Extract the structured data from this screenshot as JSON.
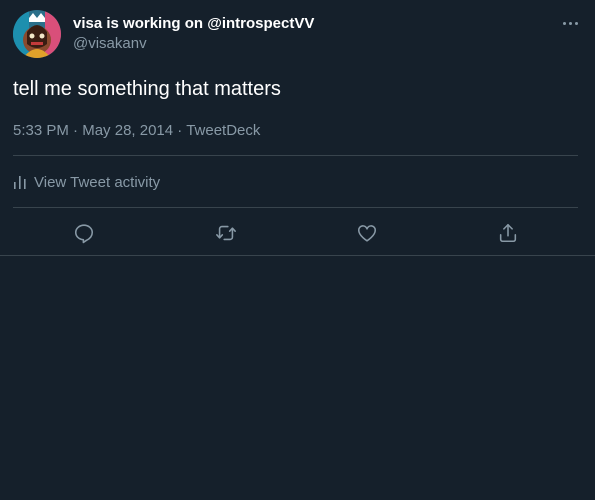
{
  "tweet": {
    "display_name": "visa is working on @introspectVV",
    "handle": "@visakanv",
    "text": "tell me something that matters",
    "time": "5:33 PM",
    "separator": " · ",
    "date": "May 28, 2014",
    "source": "TweetDeck"
  },
  "activity": {
    "label": "View Tweet activity"
  },
  "actions": {
    "icons": [
      "reply-icon",
      "retweet-icon",
      "like-icon",
      "share-icon"
    ]
  },
  "colors": {
    "background": "#15202b",
    "text": "#ffffff",
    "muted": "#8899a6",
    "border": "#38444d"
  }
}
